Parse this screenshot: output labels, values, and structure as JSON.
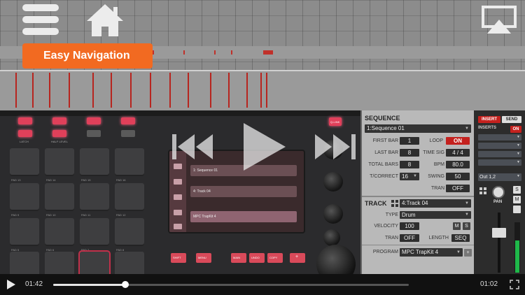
{
  "overlay": {
    "tooltip_text": "Easy Navigation",
    "menu_icon": "menu-icon",
    "home_icon": "home-icon",
    "airplay_icon": "airplay-icon"
  },
  "sequence": {
    "header": "SEQUENCE",
    "selected": "1:Sequence 01",
    "first_bar_label": "FIRST BAR",
    "first_bar_value": "1",
    "loop_label": "LOOP",
    "loop_value": "ON",
    "last_bar_label": "LAST BAR",
    "last_bar_value": "8",
    "time_sig_label": "TIME SIG",
    "time_sig_value": "4 / 4",
    "total_bars_label": "TOTAL BARS",
    "total_bars_value": "8",
    "bpm_label": "BPM",
    "bpm_value": "80.0",
    "t_correct_label": "T/CORRECT",
    "t_correct_value": "16",
    "swing_label": "SWING",
    "swing_value": "50",
    "tran_label": "TRAN",
    "tran_value": "OFF"
  },
  "track": {
    "header": "TRACK",
    "selected": "4:Track 04",
    "type_label": "TYPE",
    "type_value": "Drum",
    "velocity_label": "VELOCITY",
    "velocity_value": "100",
    "m_label": "M",
    "s_label": "S",
    "tran_label": "TRAN",
    "tran_value": "OFF",
    "length_label": "LENGTH",
    "length_value": "SEQ",
    "program_label": "PROGRAM",
    "program_value": "MPC TrapKit 4",
    "add_label": "+"
  },
  "mixer": {
    "insert_tab": "INSERT",
    "send_tab": "SEND",
    "inserts_label": "INSERTS",
    "inserts_toggle": "ON",
    "output": "Out 1,2",
    "pan_label": "PAN",
    "s_label": "S",
    "m_label": "M"
  },
  "hardware": {
    "latch_label": "LATCH",
    "half_level_label": "HALF LEVEL",
    "qlink_label": "Q-LINK",
    "shift_label": "SHIFT",
    "menu_label": "MENU",
    "main_label": "MAIN",
    "undo_label": "UNDO",
    "copy_label": "COPY",
    "plus_label": "+",
    "screen_row1": "1: Sequence 01",
    "screen_row2": "4: Track 04",
    "screen_row3": "MPC TrapKit 4"
  },
  "player": {
    "elapsed": "01:42",
    "remaining": "01:02",
    "progress_fraction": 0.202
  }
}
